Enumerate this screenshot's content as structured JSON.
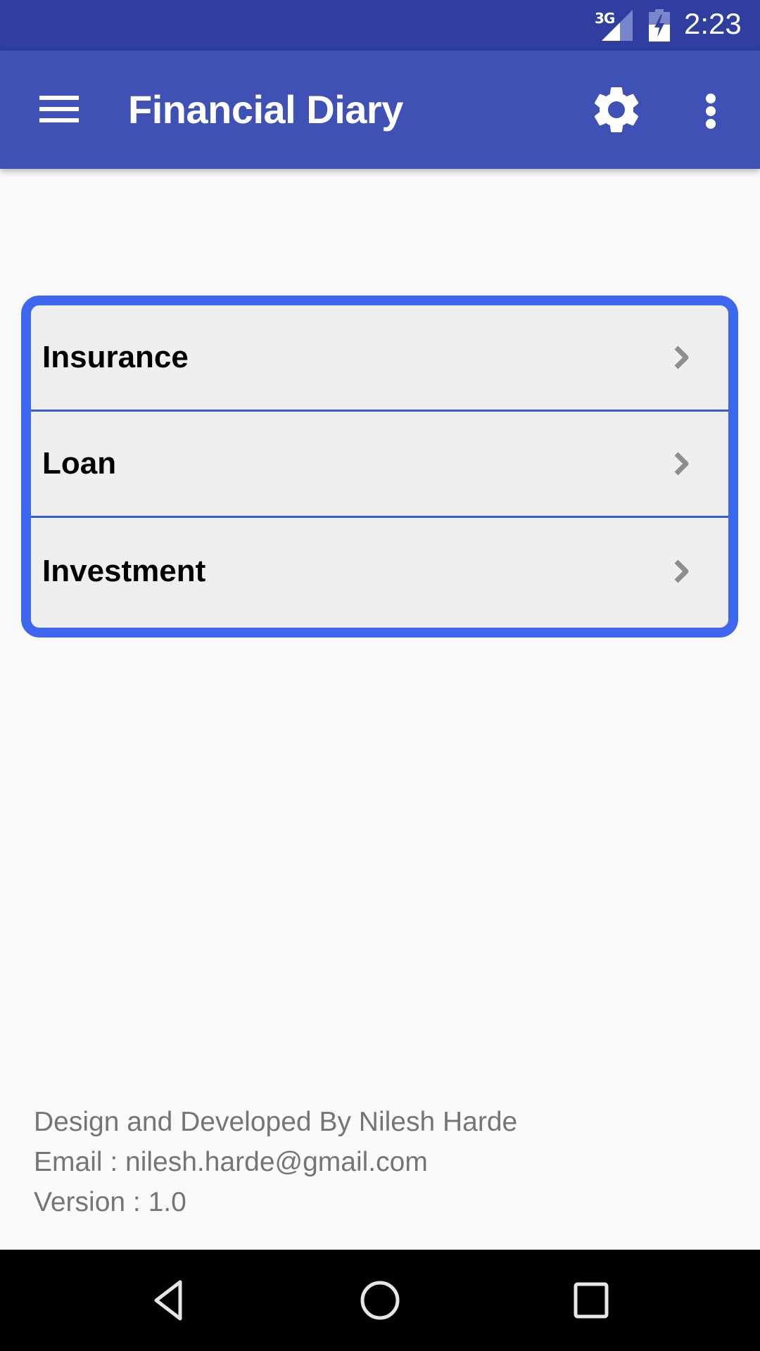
{
  "status_bar": {
    "network_type": "3G",
    "time": "2:23",
    "icons": [
      "signal-icon",
      "battery-charging-icon"
    ]
  },
  "app_bar": {
    "title": "Financial Diary",
    "icons": [
      "menu-icon",
      "settings-gear-icon",
      "more-vert-icon"
    ]
  },
  "colors": {
    "app_bar": "#3f51b5",
    "status_bar": "#303f9f",
    "card_border": "#3e67f0",
    "row_background": "#efefef",
    "footer_text": "#757575"
  },
  "menu": {
    "items": [
      {
        "label": "Insurance",
        "icon": "chevron-right-icon"
      },
      {
        "label": "Loan",
        "icon": "chevron-right-icon"
      },
      {
        "label": "Investment",
        "icon": "chevron-right-icon"
      }
    ]
  },
  "footer": {
    "credit": "Design and Developed By Nilesh Harde",
    "email": "Email : nilesh.harde@gmail.com",
    "version": "Version : 1.0"
  },
  "nav_bar": {
    "buttons": [
      "back-icon",
      "home-icon",
      "recents-icon"
    ]
  }
}
